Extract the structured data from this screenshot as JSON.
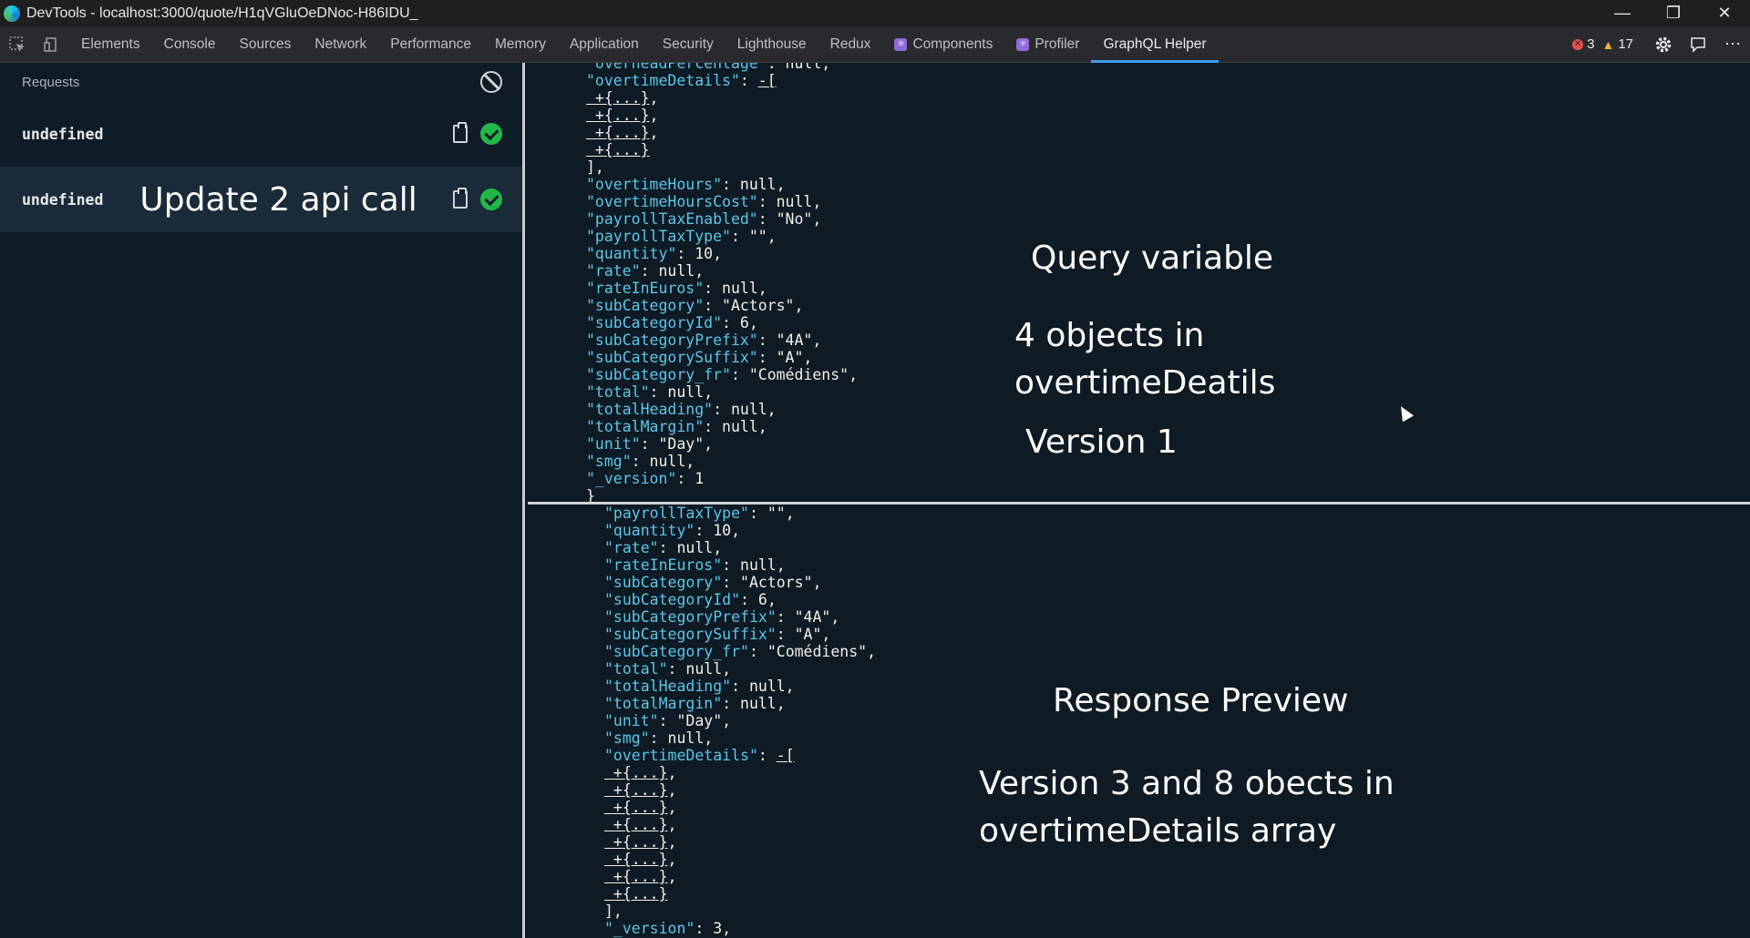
{
  "window": {
    "title": "DevTools - localhost:3000/quote/H1qVGluOeDNoc-H86IDU_",
    "controls": [
      "—",
      "❐",
      "✕"
    ]
  },
  "tabs": [
    {
      "label": "Elements"
    },
    {
      "label": "Console"
    },
    {
      "label": "Sources"
    },
    {
      "label": "Network"
    },
    {
      "label": "Performance"
    },
    {
      "label": "Memory"
    },
    {
      "label": "Application"
    },
    {
      "label": "Security"
    },
    {
      "label": "Lighthouse"
    },
    {
      "label": "Redux"
    },
    {
      "label": "Components"
    },
    {
      "label": "Profiler"
    },
    {
      "label": "GraphQL Helper",
      "active": true
    }
  ],
  "status": {
    "errors": "3",
    "warnings": "17"
  },
  "sidebar": {
    "header": "Requests",
    "requests": [
      {
        "name": "undefined",
        "annotation": ""
      },
      {
        "name": "undefined",
        "annotation": "Update 2 api call"
      }
    ]
  },
  "query_pane": {
    "lines": [
      [
        [
          "k",
          "\"overheadPercentage\""
        ],
        [
          "v",
          ": null,"
        ]
      ],
      [
        [
          "k",
          "\"overtimeDetails\""
        ],
        [
          "v",
          ": "
        ],
        [
          "lnk",
          "-["
        ]
      ],
      [
        [
          "plus",
          " +"
        ],
        [
          "lnk",
          "{...}"
        ],
        [
          "v",
          ","
        ]
      ],
      [
        [
          "plus",
          " +"
        ],
        [
          "lnk",
          "{...}"
        ],
        [
          "v",
          ","
        ]
      ],
      [
        [
          "plus",
          " +"
        ],
        [
          "lnk",
          "{...}"
        ],
        [
          "v",
          ","
        ]
      ],
      [
        [
          "plus",
          " +"
        ],
        [
          "lnk",
          "{...}"
        ]
      ],
      [
        [
          "v",
          "],"
        ]
      ],
      [
        [
          "k",
          "\"overtimeHours\""
        ],
        [
          "v",
          ": null,"
        ]
      ],
      [
        [
          "k",
          "\"overtimeHoursCost\""
        ],
        [
          "v",
          ": null,"
        ]
      ],
      [
        [
          "k",
          "\"payrollTaxEnabled\""
        ],
        [
          "v",
          ": \"No\","
        ]
      ],
      [
        [
          "k",
          "\"payrollTaxType\""
        ],
        [
          "v",
          ": \"\","
        ]
      ],
      [
        [
          "k",
          "\"quantity\""
        ],
        [
          "v",
          ": 10,"
        ]
      ],
      [
        [
          "k",
          "\"rate\""
        ],
        [
          "v",
          ": null,"
        ]
      ],
      [
        [
          "k",
          "\"rateInEuros\""
        ],
        [
          "v",
          ": null,"
        ]
      ],
      [
        [
          "k",
          "\"subCategory\""
        ],
        [
          "v",
          ": \"Actors\","
        ]
      ],
      [
        [
          "k",
          "\"subCategoryId\""
        ],
        [
          "v",
          ": 6,"
        ]
      ],
      [
        [
          "k",
          "\"subCategoryPrefix\""
        ],
        [
          "v",
          ": \"4A\","
        ]
      ],
      [
        [
          "k",
          "\"subCategorySuffix\""
        ],
        [
          "v",
          ": \"A\","
        ]
      ],
      [
        [
          "k",
          "\"subCategory_fr\""
        ],
        [
          "v",
          ": \"Comédiens\","
        ]
      ],
      [
        [
          "k",
          "\"total\""
        ],
        [
          "v",
          ": null,"
        ]
      ],
      [
        [
          "k",
          "\"totalHeading\""
        ],
        [
          "v",
          ": null,"
        ]
      ],
      [
        [
          "k",
          "\"totalMargin\""
        ],
        [
          "v",
          ": null,"
        ]
      ],
      [
        [
          "k",
          "\"unit\""
        ],
        [
          "v",
          ": \"Day\","
        ]
      ],
      [
        [
          "k",
          "\"smg\""
        ],
        [
          "v",
          ": null,"
        ]
      ],
      [
        [
          "k",
          "\"_version\""
        ],
        [
          "v",
          ": 1"
        ]
      ],
      [
        [
          "v",
          "}"
        ]
      ]
    ],
    "annotations": {
      "title": "Query variable",
      "line1": "4 objects in",
      "line2": "overtimeDeatils",
      "line3": "Version 1"
    }
  },
  "response_pane": {
    "lines": [
      [
        [
          "k",
          "\"payrollTaxType\""
        ],
        [
          "v",
          ": \"\","
        ]
      ],
      [
        [
          "k",
          "\"quantity\""
        ],
        [
          "v",
          ": 10,"
        ]
      ],
      [
        [
          "k",
          "\"rate\""
        ],
        [
          "v",
          ": null,"
        ]
      ],
      [
        [
          "k",
          "\"rateInEuros\""
        ],
        [
          "v",
          ": null,"
        ]
      ],
      [
        [
          "k",
          "\"subCategory\""
        ],
        [
          "v",
          ": \"Actors\","
        ]
      ],
      [
        [
          "k",
          "\"subCategoryId\""
        ],
        [
          "v",
          ": 6,"
        ]
      ],
      [
        [
          "k",
          "\"subCategoryPrefix\""
        ],
        [
          "v",
          ": \"4A\","
        ]
      ],
      [
        [
          "k",
          "\"subCategorySuffix\""
        ],
        [
          "v",
          ": \"A\","
        ]
      ],
      [
        [
          "k",
          "\"subCategory_fr\""
        ],
        [
          "v",
          ": \"Comédiens\","
        ]
      ],
      [
        [
          "k",
          "\"total\""
        ],
        [
          "v",
          ": null,"
        ]
      ],
      [
        [
          "k",
          "\"totalHeading\""
        ],
        [
          "v",
          ": null,"
        ]
      ],
      [
        [
          "k",
          "\"totalMargin\""
        ],
        [
          "v",
          ": null,"
        ]
      ],
      [
        [
          "k",
          "\"unit\""
        ],
        [
          "v",
          ": \"Day\","
        ]
      ],
      [
        [
          "k",
          "\"smg\""
        ],
        [
          "v",
          ": null,"
        ]
      ],
      [
        [
          "k",
          "\"overtimeDetails\""
        ],
        [
          "v",
          ": "
        ],
        [
          "lnk",
          "-["
        ]
      ],
      [
        [
          "plus",
          " +"
        ],
        [
          "lnk",
          "{...}"
        ],
        [
          "v",
          ","
        ]
      ],
      [
        [
          "plus",
          " +"
        ],
        [
          "lnk",
          "{...}"
        ],
        [
          "v",
          ","
        ]
      ],
      [
        [
          "plus",
          " +"
        ],
        [
          "lnk",
          "{...}"
        ],
        [
          "v",
          ","
        ]
      ],
      [
        [
          "plus",
          " +"
        ],
        [
          "lnk",
          "{...}"
        ],
        [
          "v",
          ","
        ]
      ],
      [
        [
          "plus",
          " +"
        ],
        [
          "lnk",
          "{...}"
        ],
        [
          "v",
          ","
        ]
      ],
      [
        [
          "plus",
          " +"
        ],
        [
          "lnk",
          "{...}"
        ],
        [
          "v",
          ","
        ]
      ],
      [
        [
          "plus",
          " +"
        ],
        [
          "lnk",
          "{...}"
        ],
        [
          "v",
          ","
        ]
      ],
      [
        [
          "plus",
          " +"
        ],
        [
          "lnk",
          "{...}"
        ]
      ],
      [
        [
          "v",
          "],"
        ]
      ],
      [
        [
          "k",
          "\"_version\""
        ],
        [
          "v",
          ": 3,"
        ]
      ]
    ],
    "annotations": {
      "title": "Response Preview",
      "line1": "Version 3 and 8 obects in",
      "line2": "overtimeDetails array"
    }
  },
  "colors": {
    "key": "#5cc6e8",
    "value": "#f0f0e8",
    "accent_tab": "#3b9bf4",
    "success": "#21b84a",
    "error": "#e8524a",
    "warning": "#f2b13b"
  }
}
